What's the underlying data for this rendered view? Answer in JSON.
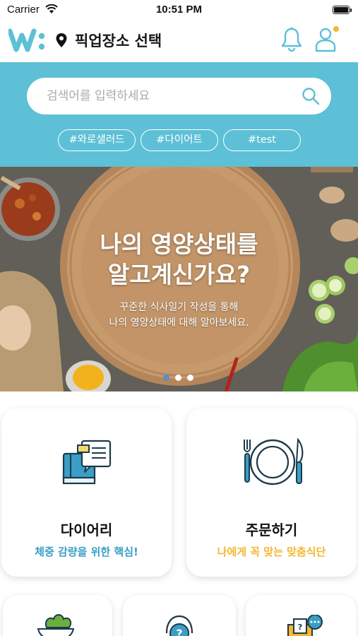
{
  "status_bar": {
    "carrier": "Carrier",
    "time": "10:51 PM"
  },
  "header": {
    "logo": "W:",
    "pickup_label": "픽업장소 선택"
  },
  "search": {
    "placeholder": "검색어를 입력하세요",
    "value": ""
  },
  "tags": [
    "#와로샐러드",
    "#다이어트",
    "#test"
  ],
  "banner": {
    "title_line1": "나의 영양상태를",
    "title_line2": "알고계신가요?",
    "subtitle_line1": "꾸준한 식사일기 작성을 통해",
    "subtitle_line2": "나의 영양상태에 대해 알아보세요.",
    "slide_count": 3,
    "active_slide": 1
  },
  "cards": [
    {
      "title": "다이어리",
      "subtitle": "체중 감량을 위한 핵심!",
      "icon": "diary-book-icon",
      "accent": "#3a9ec6"
    },
    {
      "title": "주문하기",
      "subtitle": "나에게 꼭 맞는 맞춤식단",
      "icon": "plate-fork-knife-icon",
      "accent": "#f5b731"
    }
  ],
  "bottom_cards": [
    {
      "icon": "salad-bowl-icon"
    },
    {
      "icon": "help-headset-icon"
    },
    {
      "icon": "mail-chat-icon"
    }
  ],
  "colors": {
    "primary": "#5dc0d6",
    "blue_accent": "#3a9ec6",
    "yellow_accent": "#f5b731",
    "notification_dot": "#f5b731"
  }
}
